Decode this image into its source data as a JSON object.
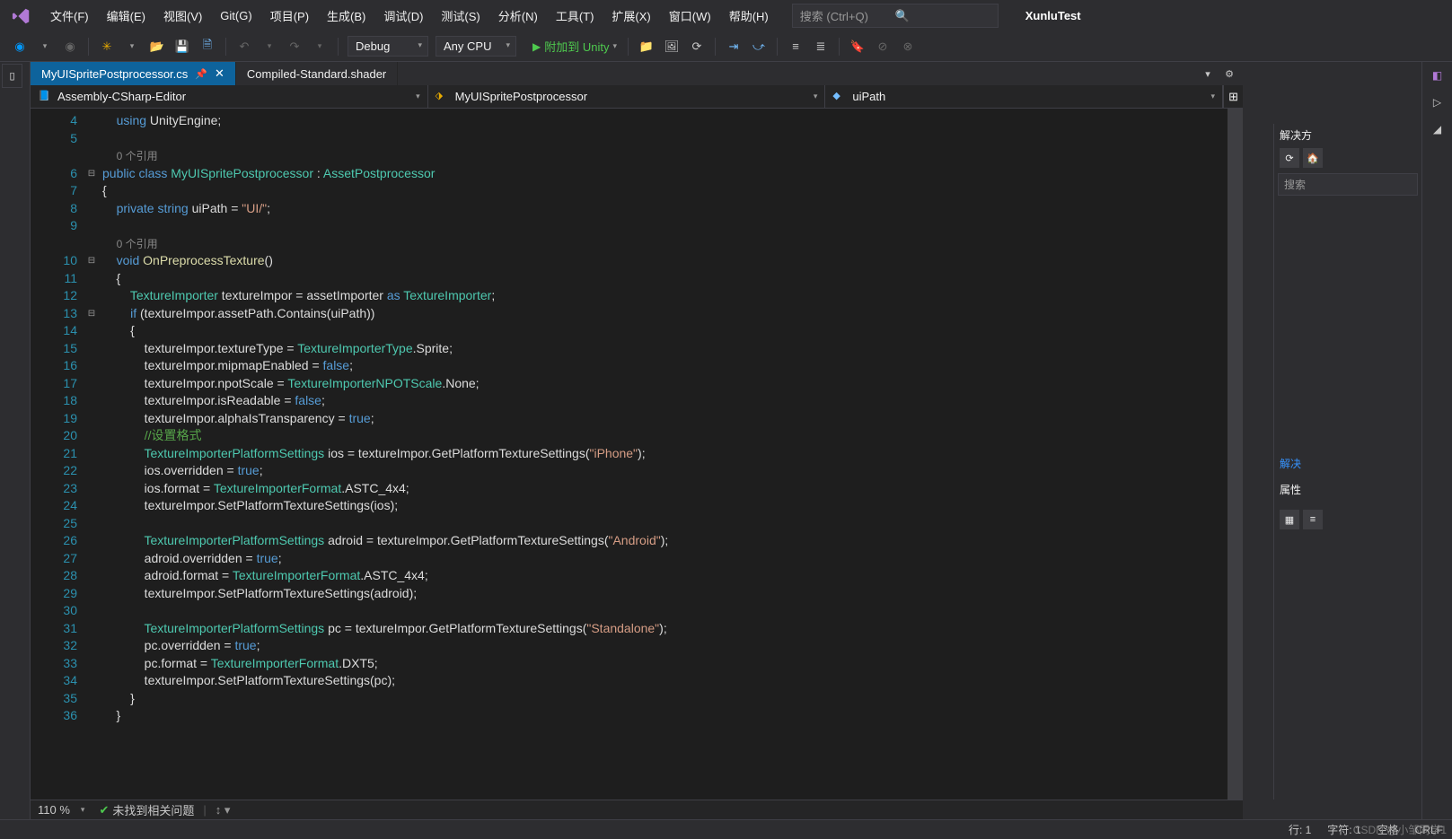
{
  "menu": {
    "file": "文件(F)",
    "edit": "编辑(E)",
    "view": "视图(V)",
    "git": "Git(G)",
    "project": "项目(P)",
    "build": "生成(B)",
    "debug": "调试(D)",
    "test": "测试(S)",
    "analyze": "分析(N)",
    "tools": "工具(T)",
    "extensions": "扩展(X)",
    "window": "窗口(W)",
    "help": "帮助(H)"
  },
  "search_placeholder": "搜索 (Ctrl+Q)",
  "project_name": "XunluTest",
  "toolbar": {
    "config": "Debug",
    "platform": "Any CPU",
    "attach": "附加到 Unity"
  },
  "tabs": [
    {
      "label": "MyUISpritePostprocessor.cs",
      "active": true
    },
    {
      "label": "Compiled-Standard.shader",
      "active": false
    }
  ],
  "nav": {
    "scope": "Assembly-CSharp-Editor",
    "class": "MyUISpritePostprocessor",
    "member": "uiPath"
  },
  "code_lines": [
    {
      "n": 4,
      "html": "    <span class='k'>using</span> UnityEngine;"
    },
    {
      "n": 5,
      "html": ""
    },
    {
      "n": "",
      "html": "    <span class='ref'>0 个引用</span>"
    },
    {
      "n": 6,
      "html": "<span class='k'>public</span> <span class='k'>class</span> <span class='t'>MyUISpritePostprocessor</span> : <span class='t'>AssetPostprocessor</span>"
    },
    {
      "n": 7,
      "html": "{"
    },
    {
      "n": 8,
      "html": "    <span class='k'>private</span> <span class='k'>string</span> uiPath = <span class='s'>\"UI/\"</span>;"
    },
    {
      "n": 9,
      "html": ""
    },
    {
      "n": "",
      "html": "    <span class='ref'>0 个引用</span>"
    },
    {
      "n": 10,
      "html": "    <span class='k'>void</span> <span class='m'>OnPreprocessTexture</span>()"
    },
    {
      "n": 11,
      "html": "    {"
    },
    {
      "n": 12,
      "html": "        <span class='t'>TextureImporter</span> textureImpor = assetImporter <span class='k'>as</span> <span class='t'>TextureImporter</span>;"
    },
    {
      "n": 13,
      "html": "        <span class='k'>if</span> (textureImpor.assetPath.Contains(uiPath))"
    },
    {
      "n": 14,
      "html": "        {"
    },
    {
      "n": 15,
      "html": "            textureImpor.textureType = <span class='t'>TextureImporterType</span>.Sprite;"
    },
    {
      "n": 16,
      "html": "            textureImpor.mipmapEnabled = <span class='k'>false</span>;"
    },
    {
      "n": 17,
      "html": "            textureImpor.npotScale = <span class='t'>TextureImporterNPOTScale</span>.None;"
    },
    {
      "n": 18,
      "html": "            textureImpor.isReadable = <span class='k'>false</span>;"
    },
    {
      "n": 19,
      "html": "            textureImpor.alphaIsTransparency = <span class='k'>true</span>;"
    },
    {
      "n": 20,
      "html": "            <span class='c'>//设置格式</span>"
    },
    {
      "n": 21,
      "html": "            <span class='t'>TextureImporterPlatformSettings</span> ios = textureImpor.GetPlatformTextureSettings(<span class='s'>\"iPhone\"</span>);"
    },
    {
      "n": 22,
      "html": "            ios.overridden = <span class='k'>true</span>;"
    },
    {
      "n": 23,
      "html": "            ios.format = <span class='t'>TextureImporterFormat</span>.ASTC_4x4;"
    },
    {
      "n": 24,
      "html": "            textureImpor.SetPlatformTextureSettings(ios);"
    },
    {
      "n": 25,
      "html": ""
    },
    {
      "n": 26,
      "html": "            <span class='t'>TextureImporterPlatformSettings</span> adroid = textureImpor.GetPlatformTextureSettings(<span class='s'>\"Android\"</span>);"
    },
    {
      "n": 27,
      "html": "            adroid.overridden = <span class='k'>true</span>;"
    },
    {
      "n": 28,
      "html": "            adroid.format = <span class='t'>TextureImporterFormat</span>.ASTC_4x4;"
    },
    {
      "n": 29,
      "html": "            textureImpor.SetPlatformTextureSettings(adroid);"
    },
    {
      "n": 30,
      "html": ""
    },
    {
      "n": 31,
      "html": "            <span class='t'>TextureImporterPlatformSettings</span> pc = textureImpor.GetPlatformTextureSettings(<span class='s'>\"Standalone\"</span>);"
    },
    {
      "n": 32,
      "html": "            pc.overridden = <span class='k'>true</span>;"
    },
    {
      "n": 33,
      "html": "            pc.format = <span class='t'>TextureImporterFormat</span>.DXT5;"
    },
    {
      "n": 34,
      "html": "            textureImpor.SetPlatformTextureSettings(pc);"
    },
    {
      "n": 35,
      "html": "        }"
    },
    {
      "n": 36,
      "html": "    }"
    }
  ],
  "fold_marks": {
    "6": "⊟",
    "10": "⊟",
    "13": "⊟"
  },
  "zoom": "110 %",
  "issues": "未找到相关问题",
  "status": {
    "line": "行: 1",
    "col": "字符: 1",
    "ins": "空格",
    "eol": "CRLF"
  },
  "right": {
    "solution": "解决方",
    "search": "搜索",
    "link": "解决",
    "props": "属性"
  },
  "watermark": "CSDN @小邹同学1"
}
